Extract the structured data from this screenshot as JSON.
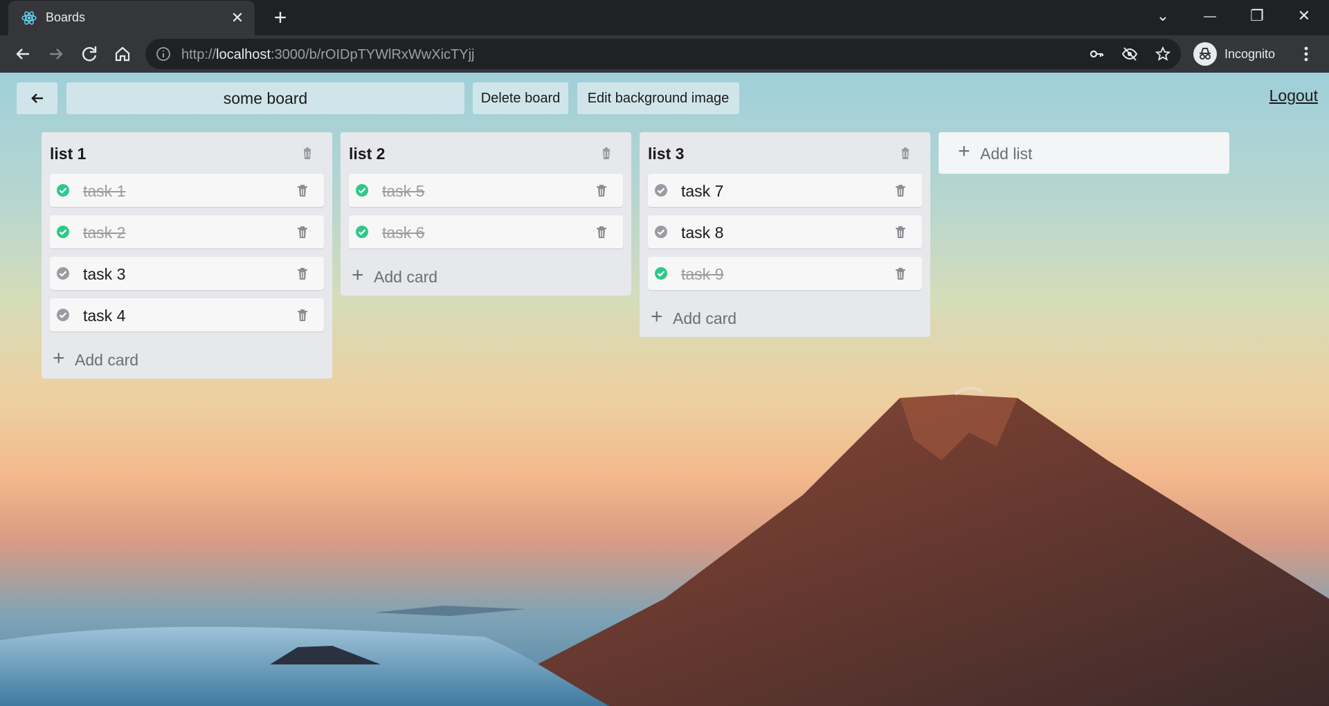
{
  "browser": {
    "tab_title": "Boards",
    "tab_close": "✕",
    "new_tab": "+",
    "url_prefix": "http://",
    "url_host": "localhost",
    "url_rest": ":3000/b/rOIDpTYWlRxWwXicTYjj",
    "profile_label": "Incognito",
    "window_controls": {
      "tab_search": "⌄",
      "minimize": "—",
      "restore": "❐",
      "close": "✕"
    }
  },
  "header": {
    "board_title": "some board",
    "delete_board_label": "Delete board",
    "edit_background_label": "Edit background image",
    "logout_label": "Logout"
  },
  "lists": [
    {
      "title": "list 1",
      "cards": [
        {
          "title": "task 1",
          "done": true
        },
        {
          "title": "task 2",
          "done": true
        },
        {
          "title": "task 3",
          "done": false
        },
        {
          "title": "task 4",
          "done": false
        }
      ],
      "add_card_label": "Add card"
    },
    {
      "title": "list 2",
      "cards": [
        {
          "title": "task 5",
          "done": true
        },
        {
          "title": "task 6",
          "done": true
        }
      ],
      "add_card_label": "Add card"
    },
    {
      "title": "list 3",
      "cards": [
        {
          "title": "task 7",
          "done": false
        },
        {
          "title": "task 8",
          "done": false
        },
        {
          "title": "task 9",
          "done": true
        }
      ],
      "add_card_label": "Add card"
    }
  ],
  "add_list_label": "Add list",
  "colors": {
    "done_check": "#2ec98a",
    "todo_check": "#9a9ca3",
    "list_bg": "#e7e8eb",
    "card_bg": "#f7f7f7"
  }
}
